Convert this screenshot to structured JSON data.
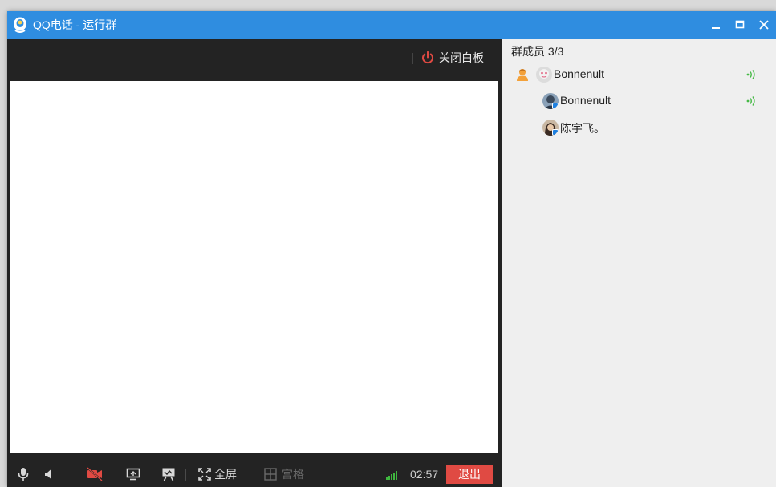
{
  "window": {
    "title": "QQ电话 - 运行群",
    "controls": {
      "minimize": "minimize-icon",
      "maximize": "maximize-icon",
      "close": "close-icon"
    }
  },
  "video": {
    "close_whiteboard_label": "关闭白板"
  },
  "toolbar": {
    "fullscreen_label": "全屏",
    "grid_label": "宫格",
    "timer": "02:57",
    "exit_label": "退出"
  },
  "members": {
    "title": "群成员 3/3",
    "items": [
      {
        "name": "Bonnenult",
        "host": true,
        "speaking": true
      },
      {
        "name": "Bonnenult",
        "host": false,
        "speaking": true
      },
      {
        "name": "陈宇飞。",
        "host": false,
        "speaking": false
      }
    ]
  },
  "colors": {
    "titlebar": "#2f8de0",
    "dark_panel": "#232323",
    "exit": "#e04a43",
    "power_icon": "#e04a43",
    "signal": "#3fb83f",
    "speaking": "#46b946"
  }
}
